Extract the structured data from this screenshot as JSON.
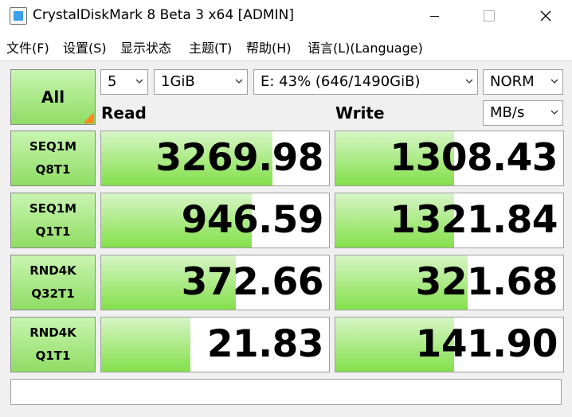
{
  "window": {
    "title": "CrystalDiskMark 8 Beta 3 x64 [ADMIN]",
    "minimize_icon": "minimize-icon",
    "maximize_icon": "maximize-icon",
    "close_icon": "close-icon"
  },
  "menu": [
    "文件(F)",
    "设置(S)",
    "显示状态",
    "主题(T)",
    "帮助(H)",
    "语言(L)(Language)"
  ],
  "controls": {
    "all_label": "All",
    "count": "5",
    "size": "1GiB",
    "drive": "E: 43% (646/1490GiB)",
    "profile": "NORM",
    "unit": "MB/s"
  },
  "headers": {
    "read": "Read",
    "write": "Write"
  },
  "tests": [
    {
      "line1": "SEQ1M",
      "line2": "Q8T1",
      "read": "3269.98",
      "write": "1308.43",
      "read_fill": 0.75,
      "write_fill": 0.52
    },
    {
      "line1": "SEQ1M",
      "line2": "Q1T1",
      "read": "946.59",
      "write": "1321.84",
      "read_fill": 0.66,
      "write_fill": 0.52
    },
    {
      "line1": "RND4K",
      "line2": "Q32T1",
      "read": "372.66",
      "write": "321.68",
      "read_fill": 0.59,
      "write_fill": 0.58
    },
    {
      "line1": "RND4K",
      "line2": "Q1T1",
      "read": "21.83",
      "write": "141.90",
      "read_fill": 0.39,
      "write_fill": 0.52
    }
  ],
  "status_text": "",
  "colors": {
    "green_light": "#d7f5c6",
    "green_dark": "#83e04a",
    "button_green": "#8fdd63",
    "corner_orange": "#ff8a1f"
  }
}
